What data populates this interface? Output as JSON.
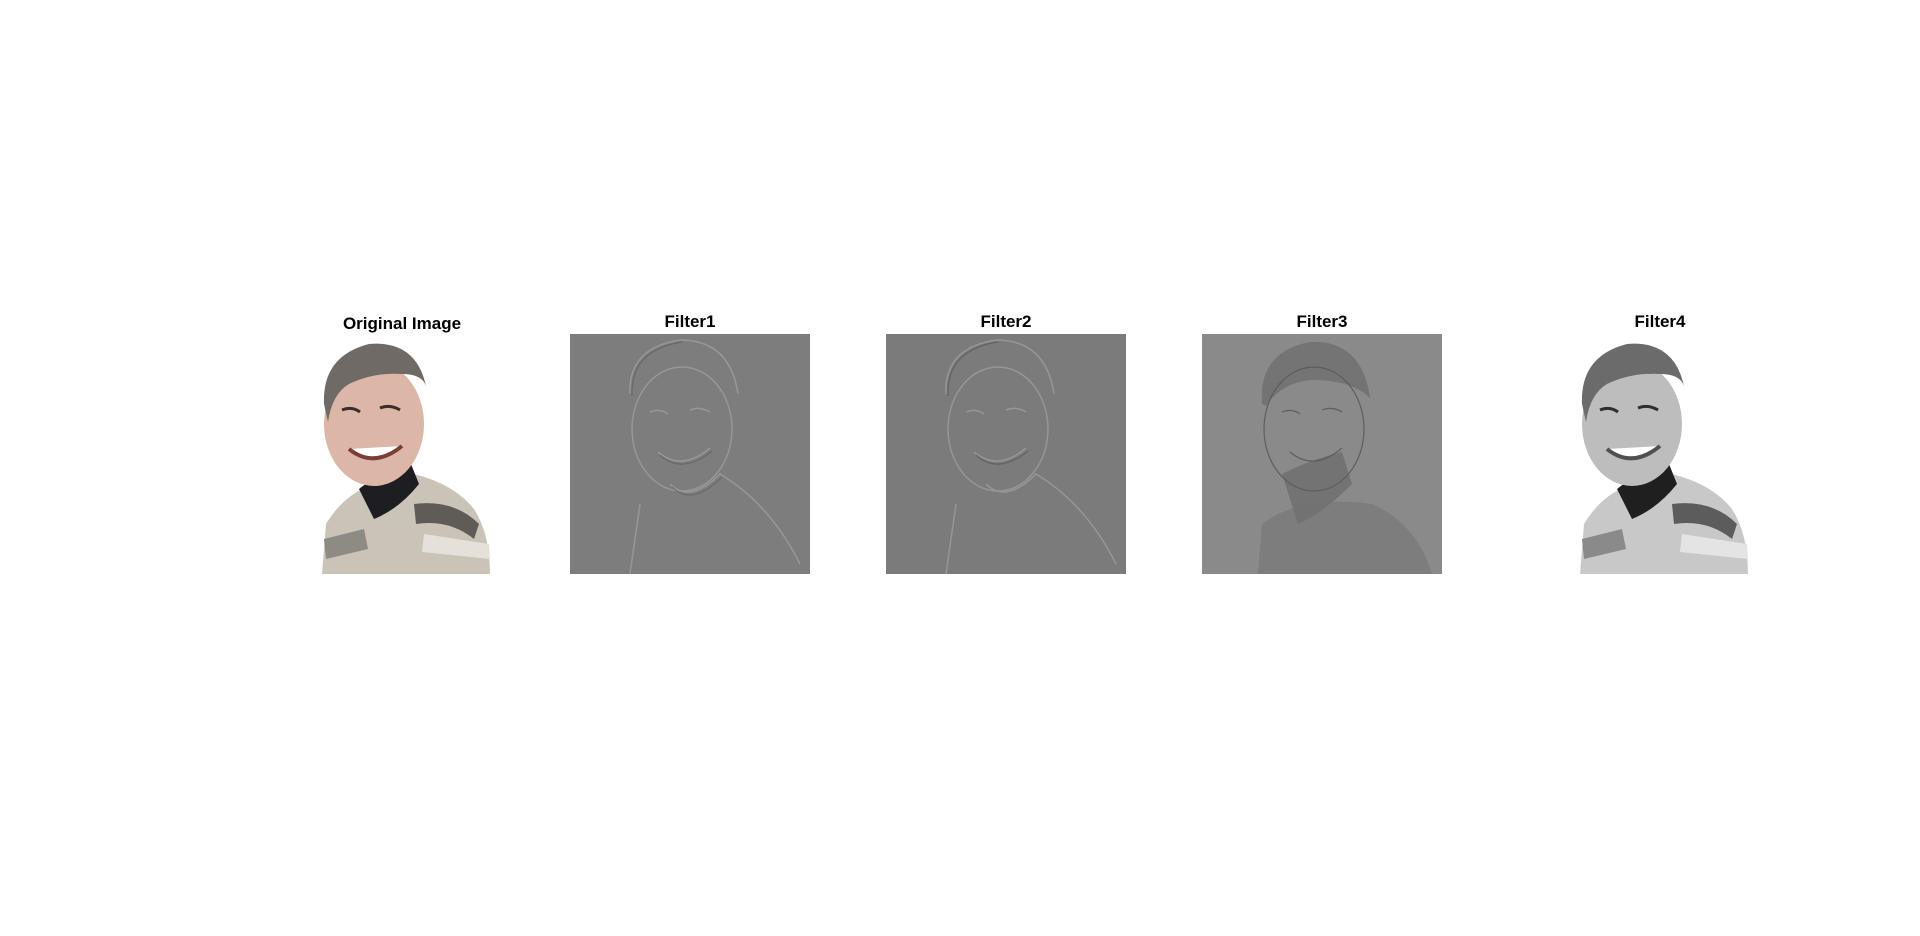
{
  "figure": {
    "panels": [
      {
        "id": "original",
        "title": "Original Image",
        "image": "portrait-photo-color",
        "background": "#ffffff"
      },
      {
        "id": "filter1",
        "title": "Filter1",
        "image": "portrait-edge-emboss",
        "background": "#7d7d7d"
      },
      {
        "id": "filter2",
        "title": "Filter2",
        "image": "portrait-edge-emboss",
        "background": "#7b7b7b"
      },
      {
        "id": "filter3",
        "title": "Filter3",
        "image": "portrait-high-pass",
        "background": "#8a8a8a"
      },
      {
        "id": "filter4",
        "title": "Filter4",
        "image": "portrait-grayscale",
        "background": "#ffffff"
      }
    ]
  }
}
